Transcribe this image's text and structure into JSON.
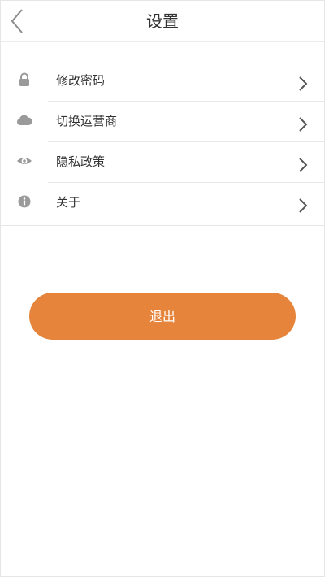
{
  "header": {
    "title": "设置",
    "back_icon": "chevron-left-icon"
  },
  "menu": {
    "items": [
      {
        "label": "修改密码",
        "icon": "lock-icon"
      },
      {
        "label": "切换运营商",
        "icon": "cloud-icon"
      },
      {
        "label": "隐私政策",
        "icon": "eye-icon"
      },
      {
        "label": "关于",
        "icon": "info-icon"
      }
    ],
    "chevron_icon": "chevron-right-icon"
  },
  "logout": {
    "label": "退出"
  },
  "colors": {
    "accent": "#e5843a",
    "icon": "#9a9a9a",
    "text": "#333333",
    "divider": "#e8e8e8"
  }
}
